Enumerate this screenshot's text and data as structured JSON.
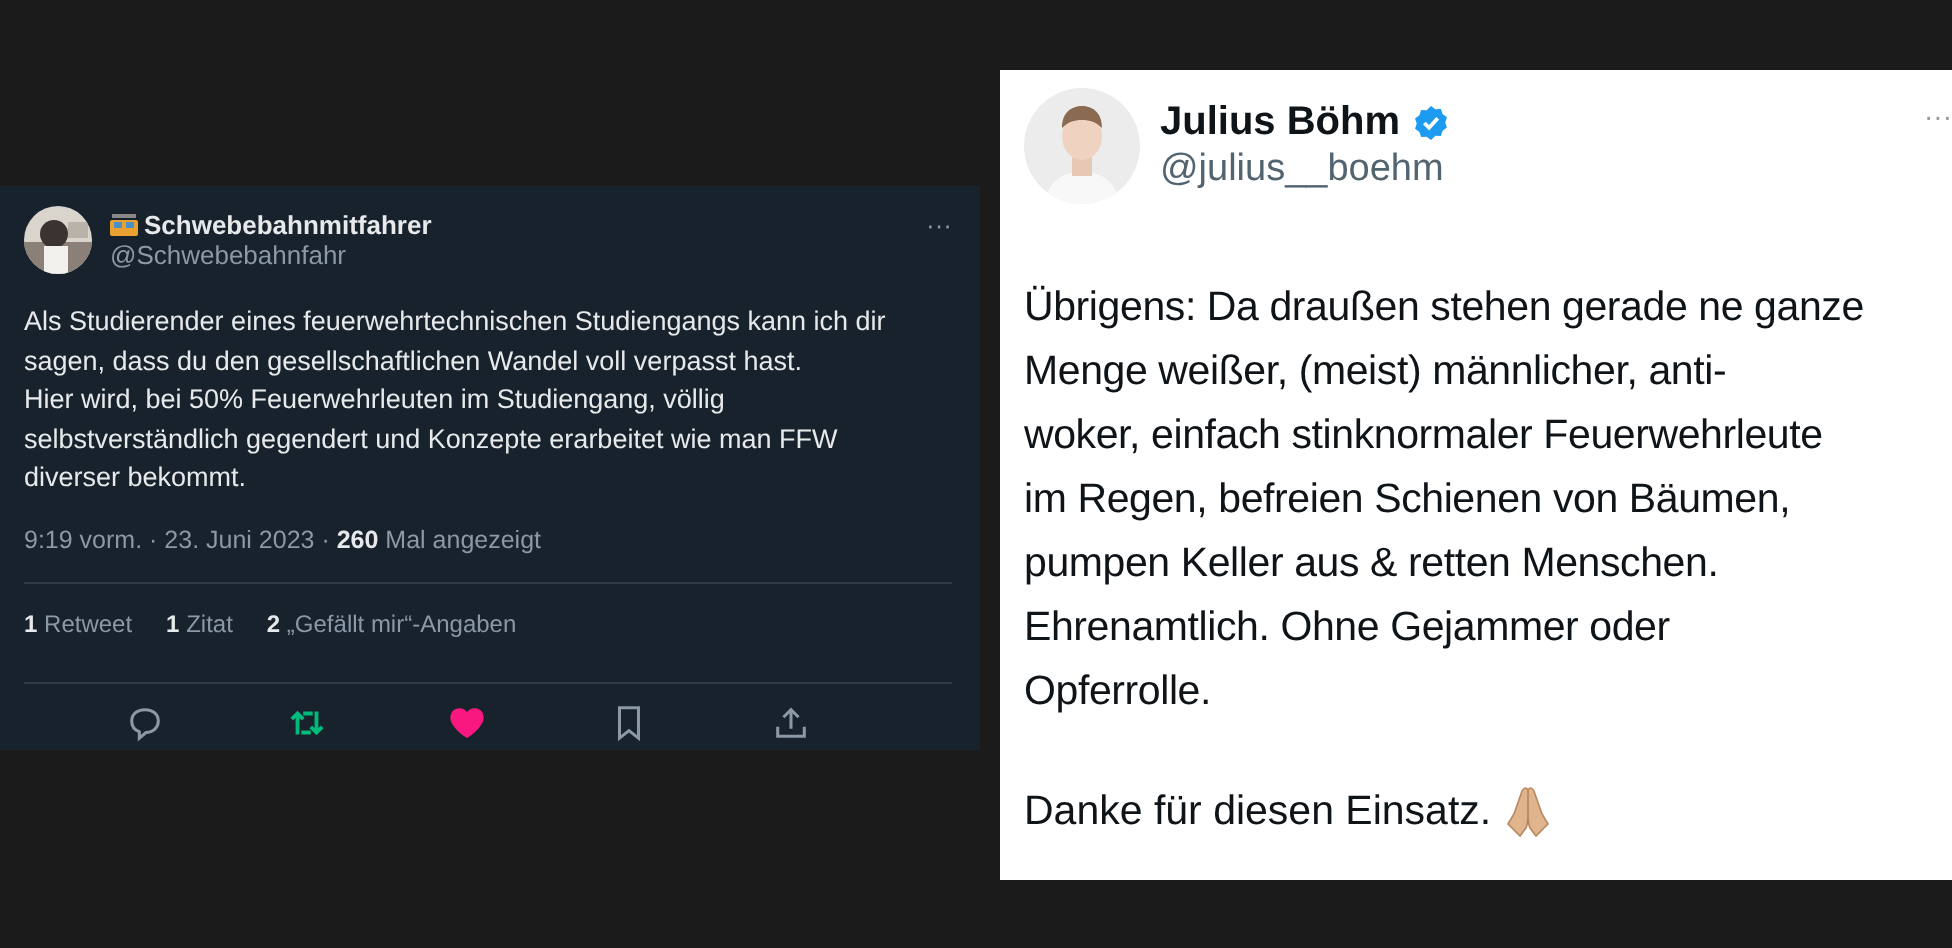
{
  "left_tweet": {
    "author": {
      "name": "Schwebebahnmitfahrer",
      "handle": "@Schwebebahnfahr"
    },
    "more": "···",
    "text": "Als Studierender eines feuerwehrtechnischen Studiengangs kann ich dir\nsagen, dass du den gesellschaftlichen Wandel voll verpasst hast.\nHier wird, bei 50% Feuerwehrleuten im Studiengang, völlig\nselbstverständlich gegendert und Konzepte erarbeitet wie man FFW\ndiverser bekommt.",
    "meta": "9:19 vorm. · 23. Juni 2023 · **260** Mal angezeigt",
    "stats": [
      "**1** Retweet",
      "**1** Zitat",
      "**2** „Gefällt mir“-Angaben"
    ],
    "actions": [
      {
        "kind": "reply",
        "on": false
      },
      {
        "kind": "retweet",
        "on": true
      },
      {
        "kind": "like",
        "on": true
      },
      {
        "kind": "bookmark",
        "on": false
      },
      {
        "kind": "share",
        "on": false
      }
    ]
  },
  "right_tweet": {
    "author": {
      "name": "Julius Böhm",
      "handle": "@julius__boehm",
      "verified": true
    },
    "more": "···",
    "text": "Übrigens: Da draußen stehen gerade ne ganze\nMenge weißer, (meist) männlicher, anti-\nwoker, einfach stinknormaler Feuerwehrleute\nim Regen, befreien Schienen von Bäumen,\npumpen Keller aus & retten Menschen.\nEhrenamtlich. Ohne Gejammer oder\nOpferrolle.",
    "closing": "Danke für diesen Einsatz."
  }
}
